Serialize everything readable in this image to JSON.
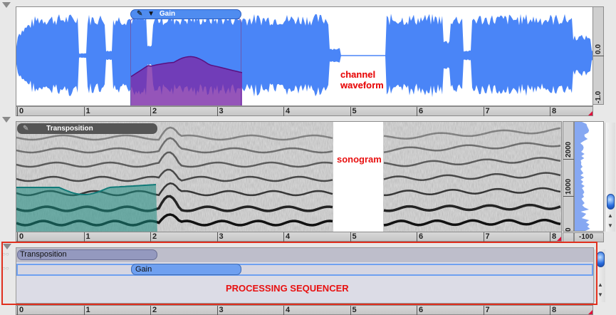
{
  "waveform": {
    "label": "channel waveform",
    "label_line1": "channel",
    "label_line2": "waveform",
    "y_ticks": [
      "0.0",
      "-1.0"
    ],
    "color": "#4a85f7",
    "gain_overlay": {
      "label": "Gain",
      "color": "#7a2aa8"
    }
  },
  "sonogram": {
    "label": "sonogram",
    "transposition_overlay": {
      "label": "Transposition",
      "color": "#1a8a80"
    },
    "freq_ticks": [
      "2000",
      "1000",
      "0"
    ],
    "spectrum_tick": "-100"
  },
  "ruler": {
    "ticks": [
      "0",
      "1",
      "2",
      "3",
      "4",
      "5",
      "6",
      "7",
      "8"
    ]
  },
  "sequencer": {
    "label": "PROCESSING SEQUENCER",
    "tracks": [
      {
        "label": "Transposition",
        "start": 0,
        "end": 2.1
      },
      {
        "label": "Gain",
        "start": 1.7,
        "end": 3.35
      }
    ]
  }
}
